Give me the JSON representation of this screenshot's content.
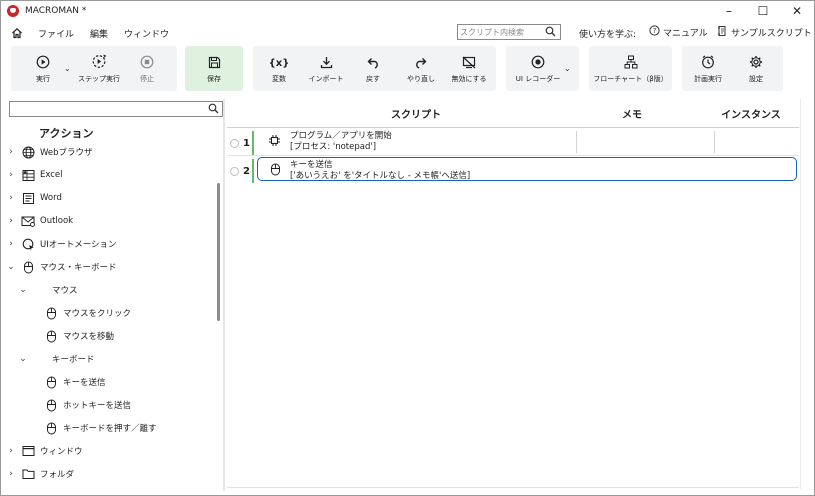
{
  "window": {
    "title": "MACROMAN *",
    "controls": {
      "minimize": "–",
      "maximize": "☐",
      "close": "✕"
    }
  },
  "menu": {
    "items": [
      "ファイル",
      "編集",
      "ウィンドウ"
    ],
    "search_placeholder": "スクリプト内検索",
    "learn": "使い方を学ぶ:",
    "manual": "マニュアル",
    "samples": "サンプルスクリプト"
  },
  "ribbon": {
    "run": "実行",
    "step_run": "ステップ実行",
    "stop": "停止",
    "save": "保存",
    "variable": "変数",
    "import": "インポート",
    "undo": "戻す",
    "redo": "やり直し",
    "disable": "無効にする",
    "ui_recorder": "UI レコーダー",
    "flowchart": "フローチャート（β版）",
    "schedule": "計画実行",
    "settings": "設定"
  },
  "left_panel": {
    "search_placeholder": "",
    "title": "アクション",
    "items": [
      {
        "label": "Webブラウザ",
        "chevron": "›",
        "icon": "globe-icon"
      },
      {
        "label": "Excel",
        "chevron": "›",
        "icon": "excel-icon"
      },
      {
        "label": "Word",
        "chevron": "›",
        "icon": "word-icon"
      },
      {
        "label": "Outlook",
        "chevron": "›",
        "icon": "outlook-icon"
      },
      {
        "label": "UIオートメーション",
        "chevron": "›",
        "icon": "ui-automation-icon"
      },
      {
        "label": "マウス・キーボード",
        "chevron": "⌄",
        "icon": "mouse-icon"
      },
      {
        "label": "マウス",
        "chevron": "⌄",
        "icon": ""
      },
      {
        "label": "マウスをクリック",
        "chevron": "",
        "icon": "mouse-icon"
      },
      {
        "label": "マウスを移動",
        "chevron": "",
        "icon": "mouse-icon"
      },
      {
        "label": "キーボード",
        "chevron": "⌄",
        "icon": ""
      },
      {
        "label": "キーを送信",
        "chevron": "",
        "icon": "mouse-icon"
      },
      {
        "label": "ホットキーを送信",
        "chevron": "",
        "icon": "mouse-icon"
      },
      {
        "label": "キーボードを押す／離す",
        "chevron": "",
        "icon": "mouse-icon"
      },
      {
        "label": "ウィンドウ",
        "chevron": "›",
        "icon": "window-icon"
      },
      {
        "label": "フォルダ",
        "chevron": "›",
        "icon": "folder-icon"
      }
    ]
  },
  "script_table": {
    "headers": {
      "script": "スクリプト",
      "memo": "メモ",
      "instance": "インスタンス"
    },
    "rows": [
      {
        "num": "1",
        "title": "プログラム／アプリを開始",
        "detail": "[プロセス: 'notepad']",
        "icon": "chip-icon",
        "selected": false
      },
      {
        "num": "2",
        "title": "キーを送信",
        "detail": "['あいうえお' を'タイトルなし - メモ帳'へ送信]",
        "icon": "mouse-icon",
        "selected": true
      }
    ]
  }
}
